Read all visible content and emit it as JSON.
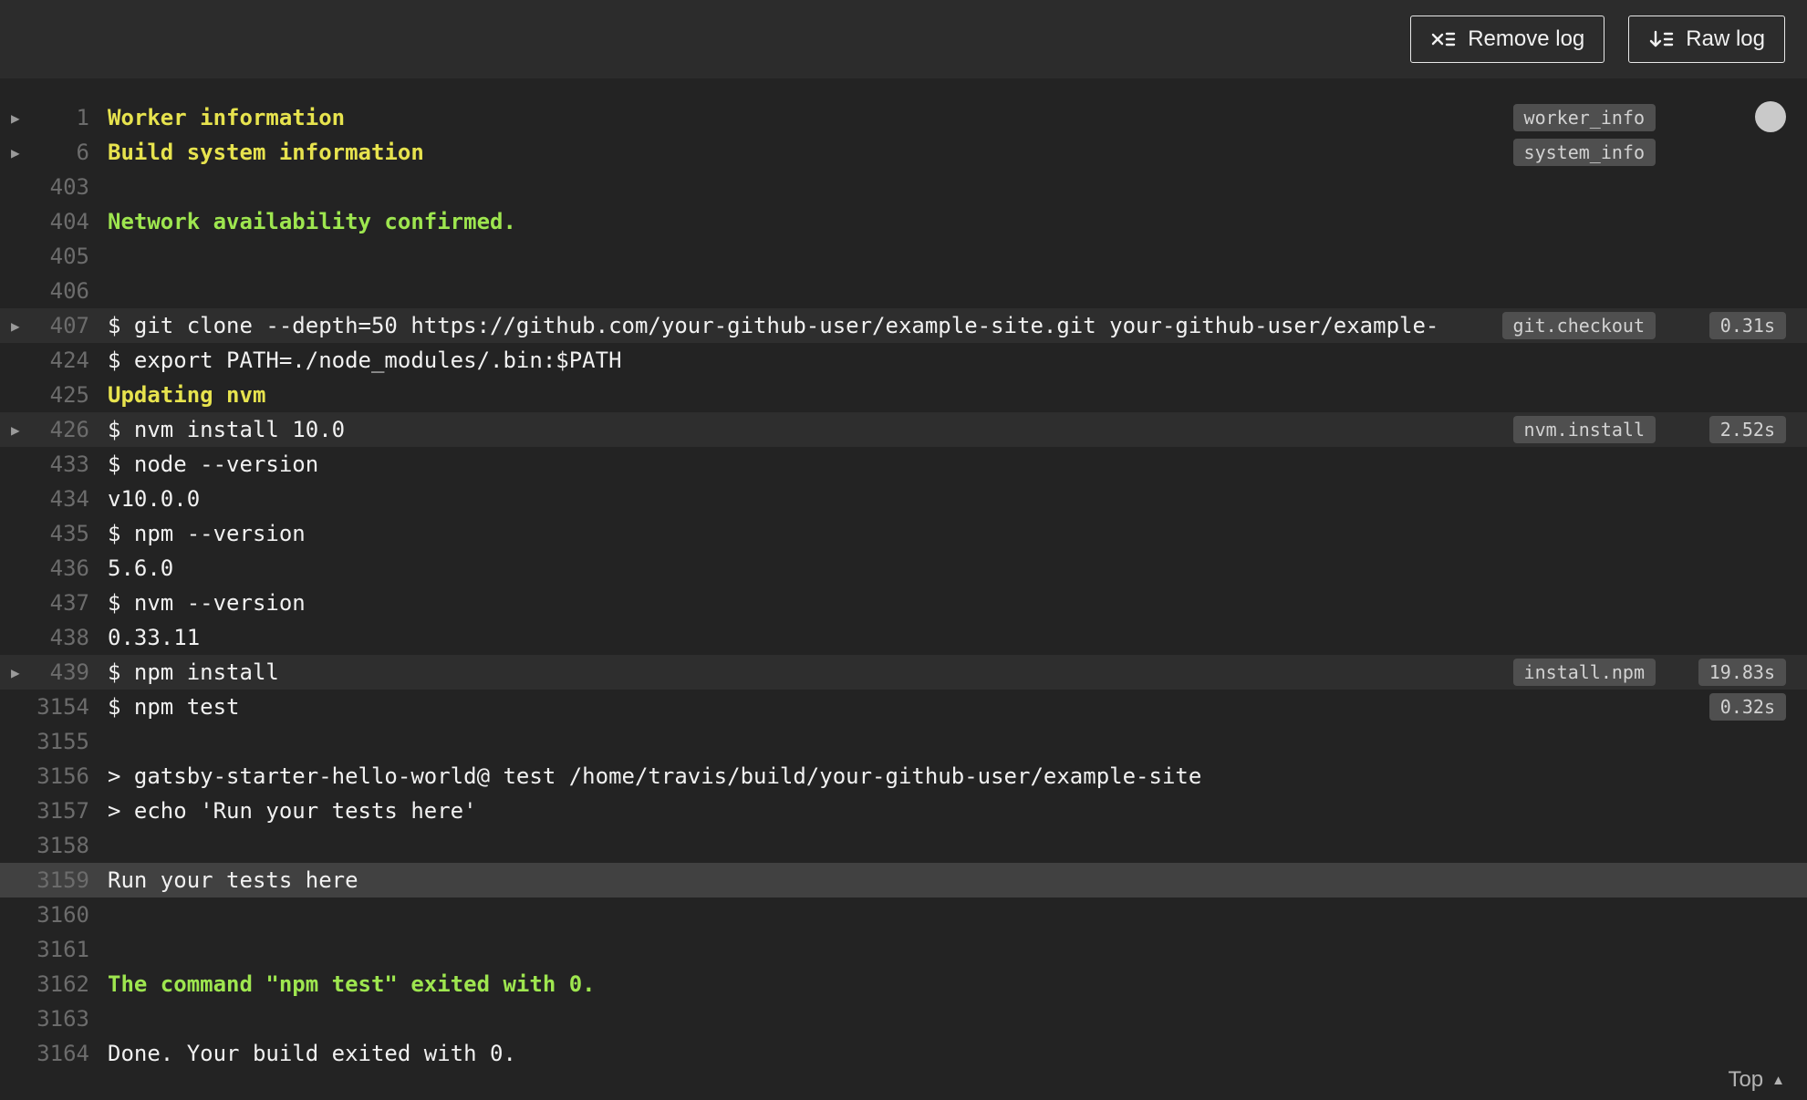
{
  "toolbar": {
    "remove_log_label": "Remove log",
    "raw_log_label": "Raw log"
  },
  "footer": {
    "top_label": "Top"
  },
  "icons": {
    "remove_log": "x-list-icon",
    "raw_log": "download-list-icon",
    "fold_closed": "▶",
    "chevron_up": "▲"
  },
  "colors": {
    "background": "#232323",
    "header_background": "#2c2c2c",
    "text_default": "#f1f1f1",
    "text_yellow": "#e7e34e",
    "text_green": "#9ee64f",
    "line_number": "#6c6c6c",
    "badge_background": "#4f4f4f",
    "row_highlight": "#2e2e2e",
    "row_selected": "#414141"
  },
  "log": {
    "lines": [
      {
        "num": "1",
        "text": "Worker information",
        "style": "yellow",
        "fold": true,
        "tag": "worker_info"
      },
      {
        "num": "6",
        "text": "Build system information",
        "style": "yellow",
        "fold": true,
        "tag": "system_info"
      },
      {
        "num": "403",
        "text": ""
      },
      {
        "num": "404",
        "text": "Network availability confirmed.",
        "style": "green"
      },
      {
        "num": "405",
        "text": ""
      },
      {
        "num": "406",
        "text": ""
      },
      {
        "num": "407",
        "text": "$ git clone --depth=50 https://github.com/your-github-user/example-site.git your-github-user/example-",
        "fold": true,
        "tag": "git.checkout",
        "duration": "0.31s",
        "highlight": true
      },
      {
        "num": "424",
        "text": "$ export PATH=./node_modules/.bin:$PATH"
      },
      {
        "num": "425",
        "text": "Updating nvm",
        "style": "yellow"
      },
      {
        "num": "426",
        "text": "$ nvm install 10.0",
        "fold": true,
        "tag": "nvm.install",
        "duration": "2.52s",
        "highlight": true
      },
      {
        "num": "433",
        "text": "$ node --version"
      },
      {
        "num": "434",
        "text": "v10.0.0"
      },
      {
        "num": "435",
        "text": "$ npm --version"
      },
      {
        "num": "436",
        "text": "5.6.0"
      },
      {
        "num": "437",
        "text": "$ nvm --version"
      },
      {
        "num": "438",
        "text": "0.33.11"
      },
      {
        "num": "439",
        "text": "$ npm install",
        "fold": true,
        "tag": "install.npm",
        "duration": "19.83s",
        "highlight": true
      },
      {
        "num": "3154",
        "text": "$ npm test",
        "duration": "0.32s"
      },
      {
        "num": "3155",
        "text": ""
      },
      {
        "num": "3156",
        "text": "> gatsby-starter-hello-world@ test /home/travis/build/your-github-user/example-site"
      },
      {
        "num": "3157",
        "text": "> echo 'Run your tests here'"
      },
      {
        "num": "3158",
        "text": ""
      },
      {
        "num": "3159",
        "text": "Run your tests here",
        "selected": true
      },
      {
        "num": "3160",
        "text": ""
      },
      {
        "num": "3161",
        "text": ""
      },
      {
        "num": "3162",
        "text": "The command \"npm test\" exited with 0.",
        "style": "green"
      },
      {
        "num": "3163",
        "text": ""
      },
      {
        "num": "3164",
        "text": "Done. Your build exited with 0."
      }
    ]
  }
}
